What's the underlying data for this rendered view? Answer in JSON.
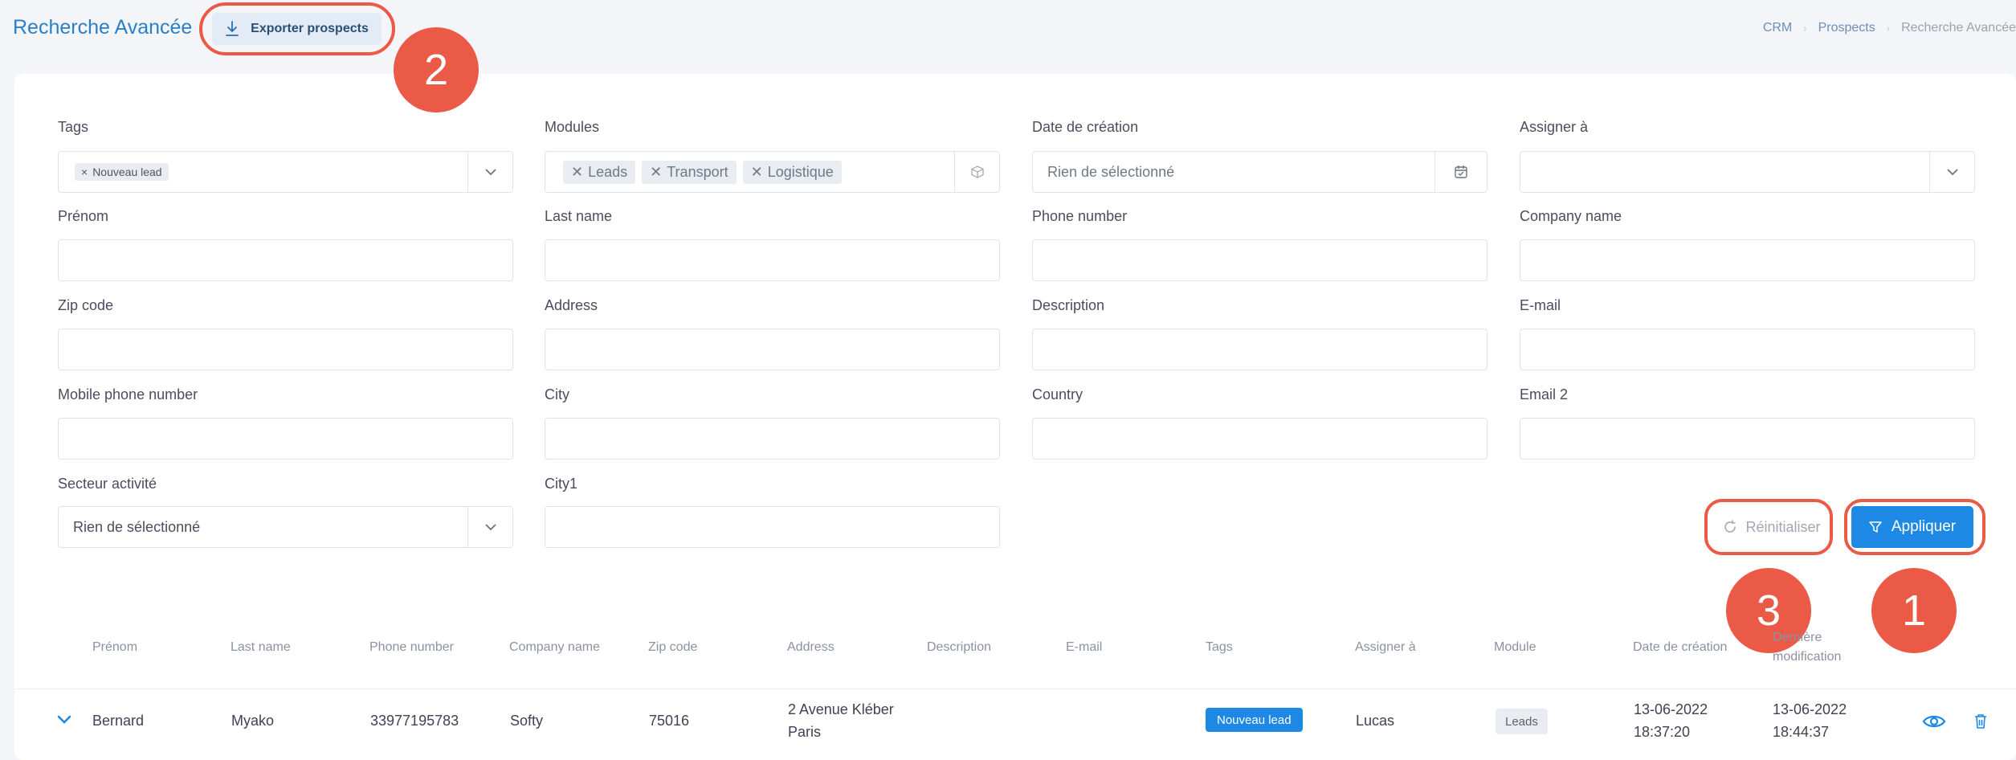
{
  "header": {
    "title": "Recherche Avancée",
    "export_label": "Exporter prospects",
    "breadcrumb": [
      "CRM",
      "Prospects",
      "Recherche Avancée"
    ]
  },
  "filters": {
    "tags": {
      "label": "Tags",
      "chips": [
        "Nouveau lead"
      ]
    },
    "modules": {
      "label": "Modules",
      "chips": [
        "Leads",
        "Transport",
        "Logistique"
      ]
    },
    "date_creation": {
      "label": "Date de création",
      "placeholder": "Rien de sélectionné"
    },
    "assigner": {
      "label": "Assigner à",
      "value": ""
    },
    "prenom": {
      "label": "Prénom"
    },
    "last_name": {
      "label": "Last name"
    },
    "phone_number": {
      "label": "Phone number"
    },
    "company_name": {
      "label": "Company name"
    },
    "zip_code": {
      "label": "Zip code"
    },
    "address": {
      "label": "Address"
    },
    "description": {
      "label": "Description"
    },
    "email": {
      "label": "E-mail"
    },
    "mobile_phone": {
      "label": "Mobile phone number"
    },
    "city": {
      "label": "City"
    },
    "country": {
      "label": "Country"
    },
    "email2": {
      "label": "Email 2"
    },
    "secteur": {
      "label": "Secteur activité",
      "placeholder": "Rien de sélectionné"
    },
    "city1": {
      "label": "City1"
    }
  },
  "actions": {
    "reset_label": "Réinitialiser",
    "apply_label": "Appliquer"
  },
  "markers": {
    "m1": "1",
    "m2": "2",
    "m3": "3"
  },
  "table": {
    "headers": {
      "prenom": "Prénom",
      "last_name": "Last name",
      "phone": "Phone number",
      "company": "Company name",
      "zip": "Zip code",
      "address": "Address",
      "description": "Description",
      "email": "E-mail",
      "tags": "Tags",
      "assigner": "Assigner à",
      "module": "Module",
      "date_creation": "Date de création",
      "derniere_line1": "Dernière",
      "derniere_line2": "modification"
    },
    "row": {
      "prenom": "Bernard",
      "last_name": "Myako",
      "phone": "33977195783",
      "company": "Softy",
      "zip": "75016",
      "address_line1": "2 Avenue Kléber",
      "address_line2": "Paris",
      "tag": "Nouveau lead",
      "assigner": "Lucas",
      "module": "Leads",
      "date_creation_line1": "13-06-2022",
      "date_creation_line2": "18:37:20",
      "derniere_line1": "13-06-2022",
      "derniere_line2": "18:44:37"
    }
  },
  "colors": {
    "accent": "#1e88e5",
    "annotation": "#ea5a47",
    "title": "#2b7fc7"
  }
}
